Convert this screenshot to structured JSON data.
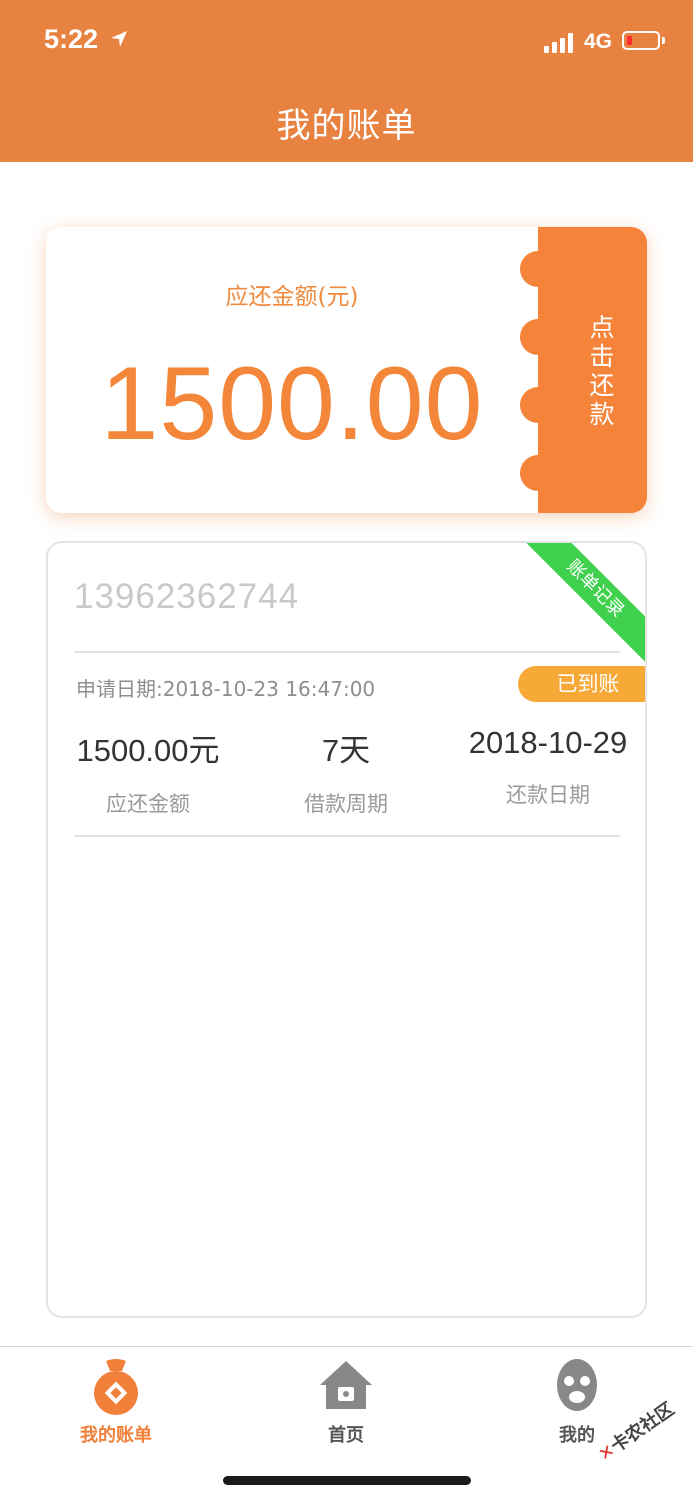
{
  "status_bar": {
    "time": "5:22",
    "network": "4G"
  },
  "header": {
    "title": "我的账单"
  },
  "repay_card": {
    "label": "应还金额(元)",
    "amount": "1500.00",
    "repay_button": "点击还款"
  },
  "bill": {
    "ribbon": "账单记录",
    "phone": "13962362744",
    "apply_date": "申请日期:2018-10-23 16:47:00",
    "status": "已到账",
    "stats": [
      {
        "value": "1500.00元",
        "label": "应还金额"
      },
      {
        "value": "7天",
        "label": "借款周期"
      },
      {
        "value": "2018-10-29",
        "label": "还款日期"
      }
    ]
  },
  "tabbar": {
    "items": [
      {
        "label": "我的账单",
        "icon": "money-bag-icon"
      },
      {
        "label": "首页",
        "icon": "home-icon"
      },
      {
        "label": "我的",
        "icon": "user-icon"
      }
    ]
  },
  "watermark": {
    "mark": "✕",
    "text": "卡农社区"
  },
  "colors": {
    "accent": "#E88240",
    "amount": "#F4863A",
    "success": "#3FD04D",
    "badge": "#F6A937"
  }
}
